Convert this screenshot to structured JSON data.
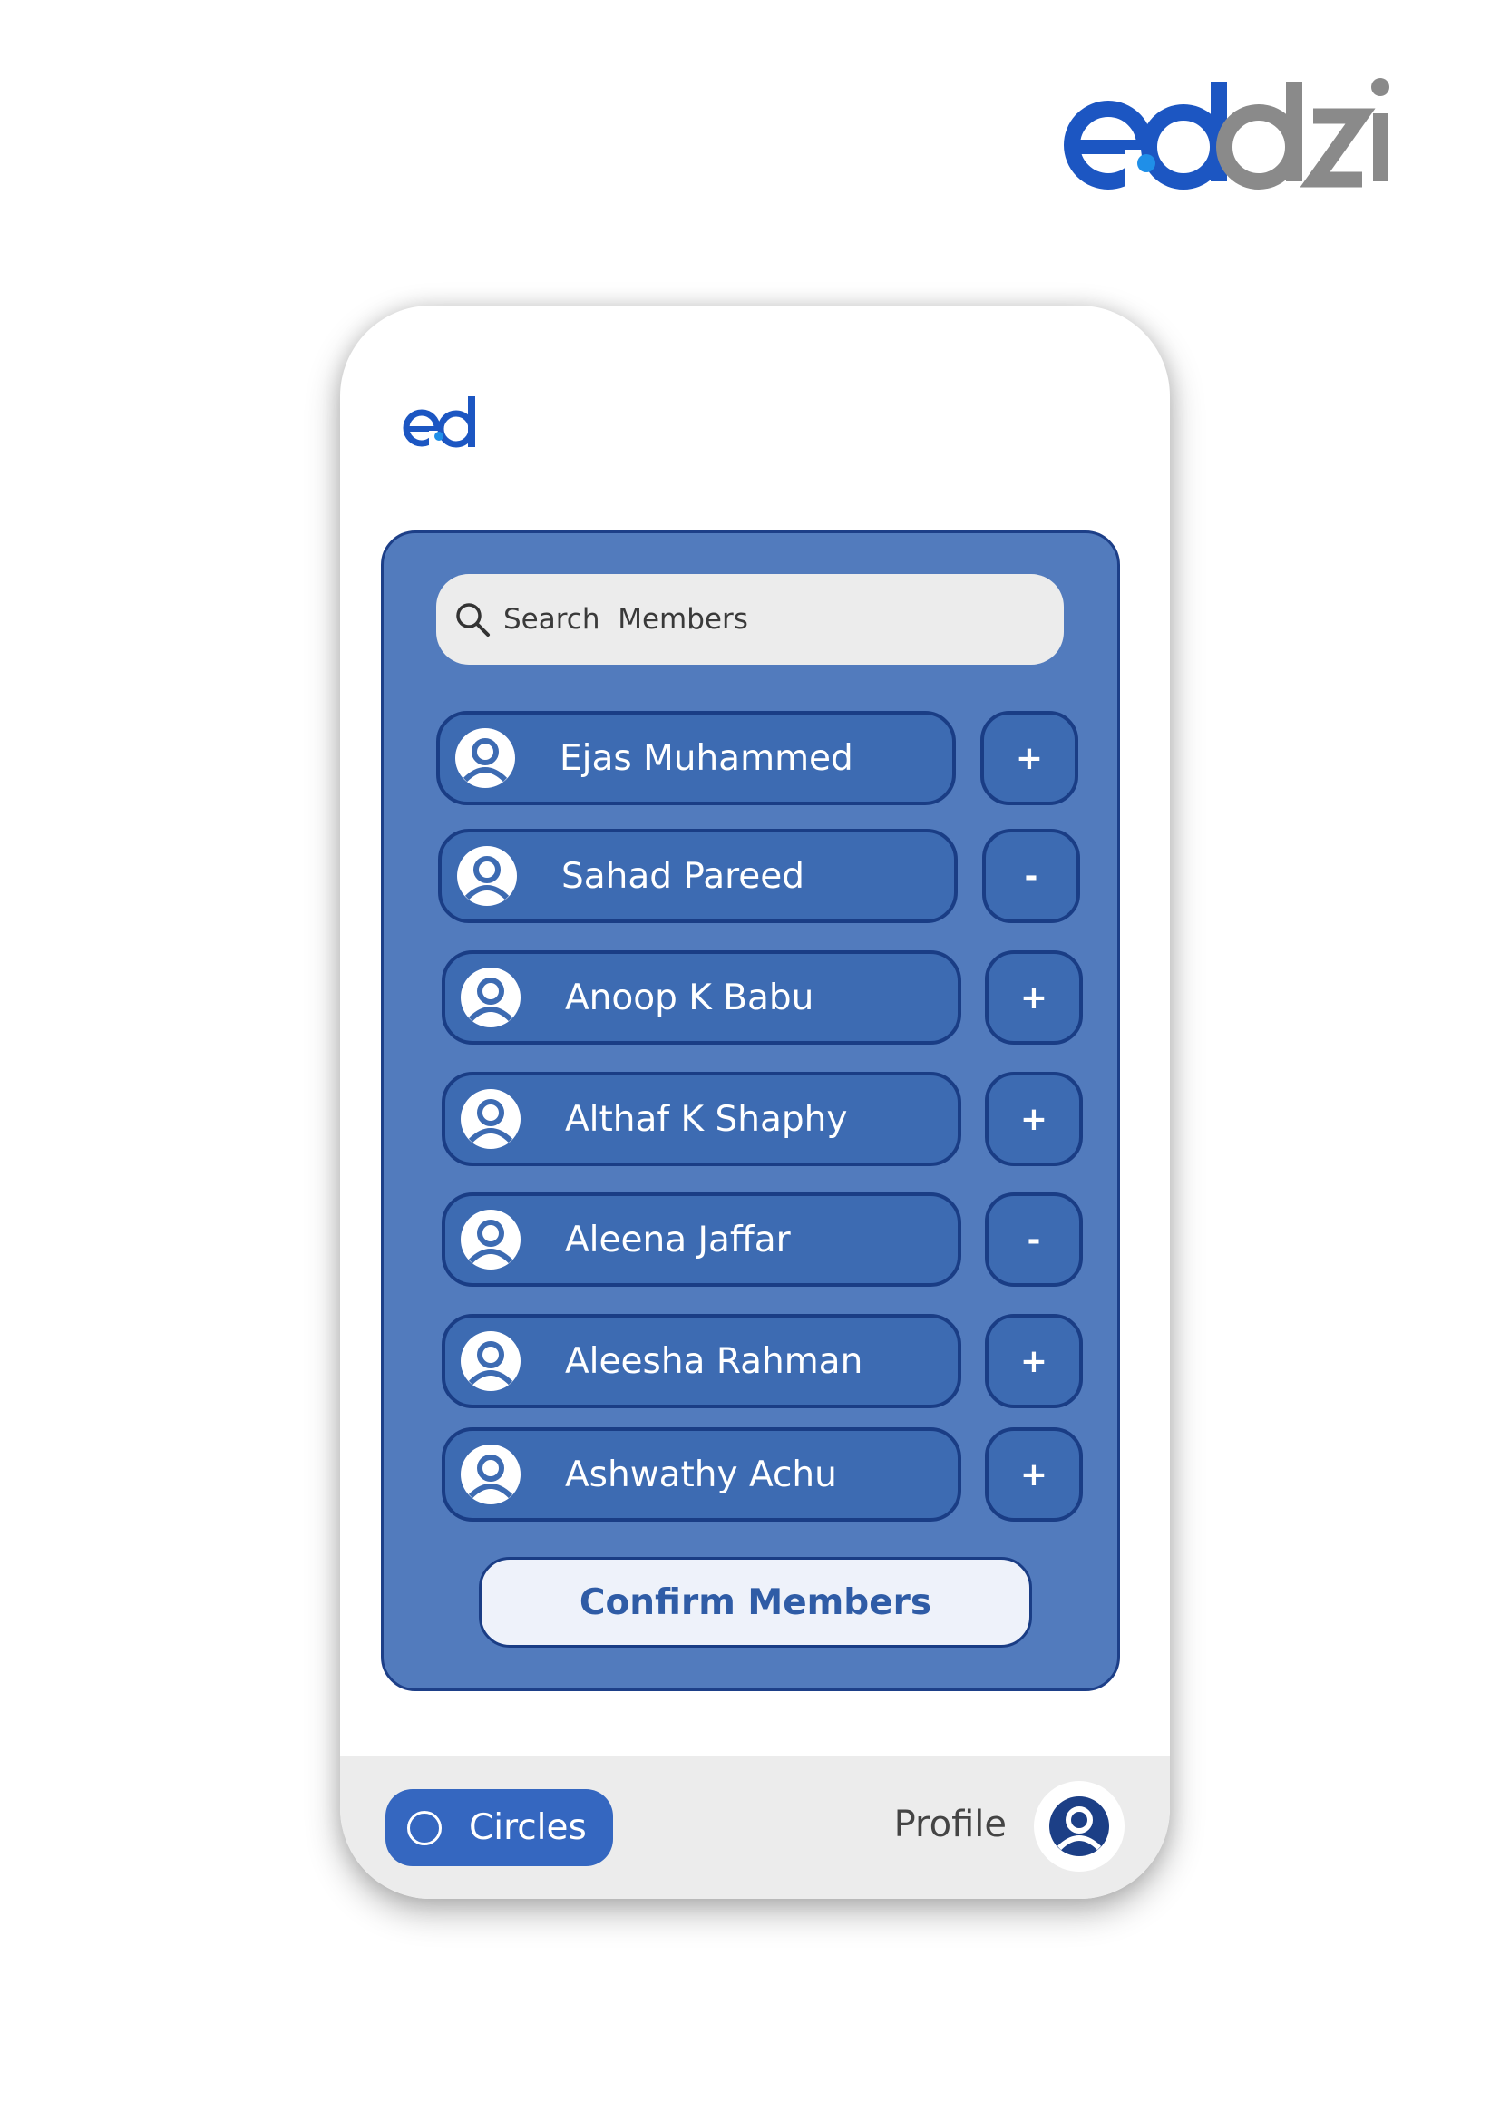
{
  "brand": {
    "logo_text": "eddzi"
  },
  "app": {
    "logo_text": "ed"
  },
  "colors": {
    "brand_blue": "#1c56c2",
    "brand_gray": "#8a8a8a",
    "panel": "#527bbd",
    "pill": "#3d6bb2",
    "pill_border": "#1a3d85",
    "nav_active": "#3567c0"
  },
  "search": {
    "placeholder": "Search  Members",
    "value": "",
    "icon": "search-icon"
  },
  "members": [
    {
      "name": "Ejas Muhammed",
      "action": "+",
      "icon": "user-icon"
    },
    {
      "name": "Sahad Pareed",
      "action": "-",
      "icon": "user-icon"
    },
    {
      "name": "Anoop K Babu",
      "action": "+",
      "icon": "user-icon"
    },
    {
      "name": "Althaf K Shaphy",
      "action": "+",
      "icon": "user-icon"
    },
    {
      "name": "Aleena Jaffar",
      "action": "-",
      "icon": "user-icon"
    },
    {
      "name": "Aleesha Rahman",
      "action": "+",
      "icon": "user-icon"
    },
    {
      "name": "Ashwathy Achu",
      "action": "+",
      "icon": "user-icon"
    }
  ],
  "confirm": {
    "label": "Confirm Members"
  },
  "nav": {
    "circles_label": "Circles",
    "circles_icon": "circle-icon",
    "profile_label": "Profile",
    "profile_icon": "user-icon"
  }
}
